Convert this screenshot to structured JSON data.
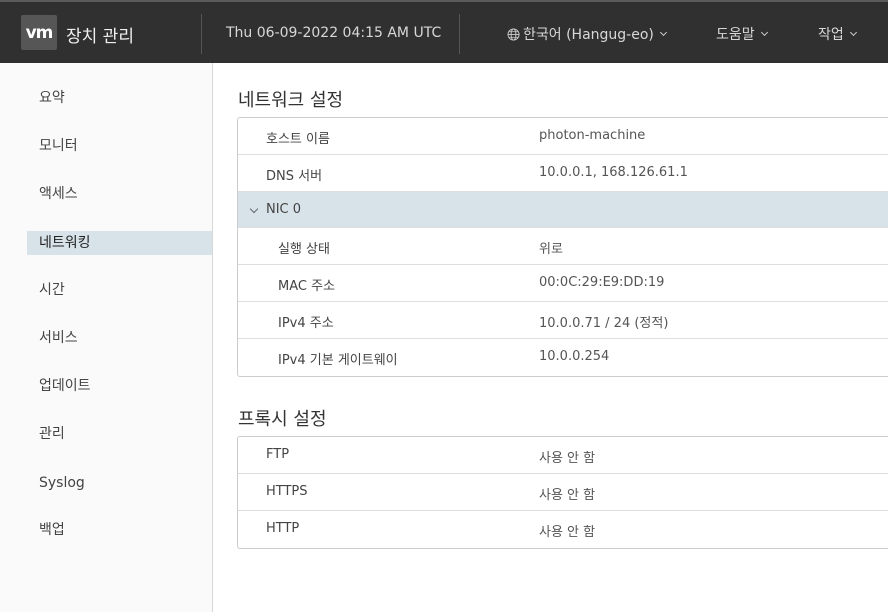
{
  "header": {
    "logo": "vm",
    "title": "장치 관리",
    "datetime": "Thu 06-09-2022 04:15 AM UTC",
    "language": "한국어 (Hangug-eo)",
    "help": "도움말",
    "actions": "작업"
  },
  "sidebar": {
    "items": [
      {
        "label": "요약"
      },
      {
        "label": "모니터"
      },
      {
        "label": "액세스"
      },
      {
        "label": "네트워킹"
      },
      {
        "label": "시간"
      },
      {
        "label": "서비스"
      },
      {
        "label": "업데이트"
      },
      {
        "label": "관리"
      },
      {
        "label": "Syslog"
      },
      {
        "label": "백업"
      }
    ],
    "active_index": 3
  },
  "network": {
    "title": "네트워크 설정",
    "hostname": {
      "label": "호스트 이름",
      "value": "photon-machine"
    },
    "dns": {
      "label": "DNS 서버",
      "value": "10.0.0.1, 168.126.61.1"
    },
    "nic": {
      "label": "NIC 0",
      "rows": [
        {
          "label": "실행 상태",
          "value": "위로"
        },
        {
          "label": "MAC 주소",
          "value": "00:0C:29:E9:DD:19"
        },
        {
          "label": "IPv4 주소",
          "value": "10.0.0.71 / 24 (정적)"
        },
        {
          "label": "IPv4 기본 게이트웨이",
          "value": "10.0.0.254"
        }
      ]
    }
  },
  "proxy": {
    "title": "프록시 설정",
    "rows": [
      {
        "label": "FTP",
        "value": "사용 안 함"
      },
      {
        "label": "HTTPS",
        "value": "사용 안 함"
      },
      {
        "label": "HTTP",
        "value": "사용 안 함"
      }
    ]
  }
}
